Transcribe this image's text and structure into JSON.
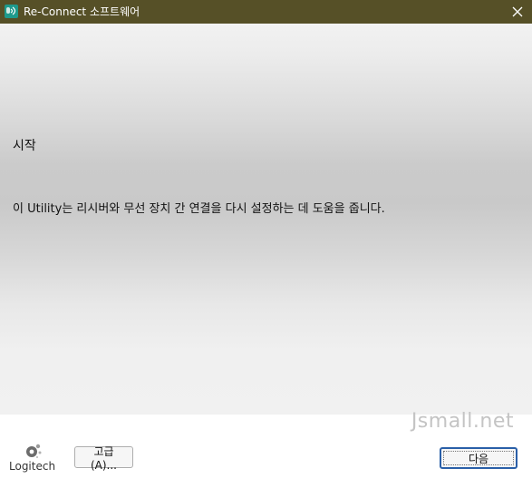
{
  "window": {
    "title": "Re-Connect 소프트웨어",
    "icon": "reconnect-app-icon",
    "close_icon": "close-icon",
    "titlebar_color": "#565027"
  },
  "main": {
    "heading": "시작",
    "description": "이 Utility는 리시버와 무선 장치 간 연결을 다시 설정하는 데 도움을 줍니다."
  },
  "footer": {
    "logo_text": "Logitech",
    "logo_icon": "logitech-logo-icon",
    "advanced_button_label": "고급(A)...",
    "next_button_label": "다음",
    "accent_color": "#2a5fa8"
  },
  "watermark": "Jsmall.net"
}
